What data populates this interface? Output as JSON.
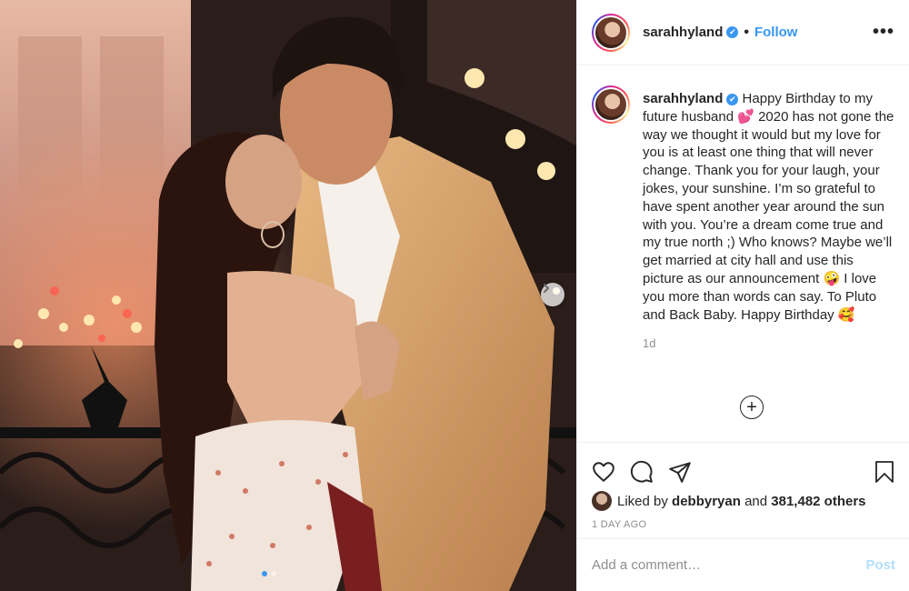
{
  "post": {
    "username": "sarahhyland",
    "verified_badge": "✔",
    "separator": "•",
    "follow_label": "Follow",
    "more_label": "•••",
    "caption": "Happy Birthday to my future husband 💕 2020 has not gone the way we thought it would but my love for you is at least one thing that will never change. Thank you for your laugh, your jokes, your sunshine. I’m so grateful to have spent another year around the sun with you. You’re a dream come true and my true north ;) Who knows? Maybe we’ll get married at city hall and use this picture as our announcement 🤪 I love you more than words can say. To Pluto and Back Baby. Happy Birthday 🥰",
    "caption_time": "1d",
    "load_more_label": "+",
    "likes": {
      "prefix": "Liked by",
      "user": "debbyryan",
      "middle": "and",
      "others": "381,482 others"
    },
    "posted_ago": "1 DAY AGO",
    "comment_placeholder": "Add a comment…",
    "post_label": "Post"
  },
  "carousel": {
    "current_index": 1,
    "total": 2
  },
  "colors": {
    "accent": "#3897f0",
    "muted": "#8e8e8e",
    "post_disabled": "#b2dffc"
  },
  "icons": [
    "heart-icon",
    "comment-icon",
    "share-icon",
    "bookmark-icon",
    "chevron-right-icon",
    "plus-circle-icon"
  ]
}
